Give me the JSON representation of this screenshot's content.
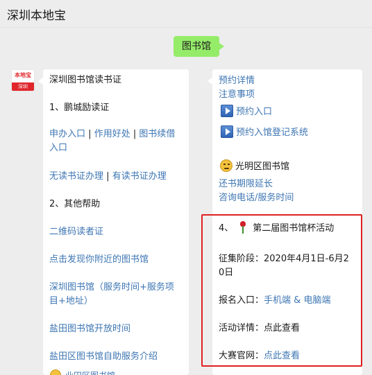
{
  "app": {
    "title": "深圳本地宝"
  },
  "keyword": "图书馆",
  "avatar": {
    "top": "本地宝",
    "bottom": "深圳"
  },
  "left": {
    "heading": "深圳图书馆读书证",
    "section1": "1、鹏城励读证",
    "apply": "申办入口",
    "benefit": "作用好处",
    "renew_line1": "图书续借",
    "renew_line2": "入口",
    "sep": "|",
    "no_card": "无读书证办理",
    "has_card": "有读书证办理",
    "section2": "2、其他帮助",
    "qr": "二维码读者证",
    "nearby": "点击发现你附近的图书馆",
    "szlib_line1": "深圳图书馆（服务时间+服务项",
    "szlib_line2": "目+地址）",
    "yantian": "盐田图书馆开放时间",
    "yantian_self": "盐田区图书馆自助服务介绍",
    "bottom_partial": "业田区图书馆"
  },
  "right": {
    "reserve_detail": "预约详情",
    "notice": "注意事项",
    "reserve_entry": "预约入口",
    "reserve_system": "预约入馆登记系统",
    "guangming": "光明区图书馆",
    "extend": "还书期限延长",
    "contact": "咨询电话/服务时间",
    "event_num": "4、",
    "event_title": "第二届图书馆杯活动",
    "period_label": "征集阶段：",
    "period_line1": "2020年4月1日-6月2",
    "period_line2": "0日",
    "signup_label": "报名入口：",
    "signup_mobile": "手机端",
    "amp": "&",
    "signup_pc": "电脑端",
    "detail_label": "活动详情：",
    "detail_link": "点此查看",
    "site_label": "大赛官网：",
    "site_link": "点此查看"
  },
  "colors": {
    "link": "#3d76b3",
    "bubble_green": "#95ec69",
    "highlight": "#e02020"
  }
}
